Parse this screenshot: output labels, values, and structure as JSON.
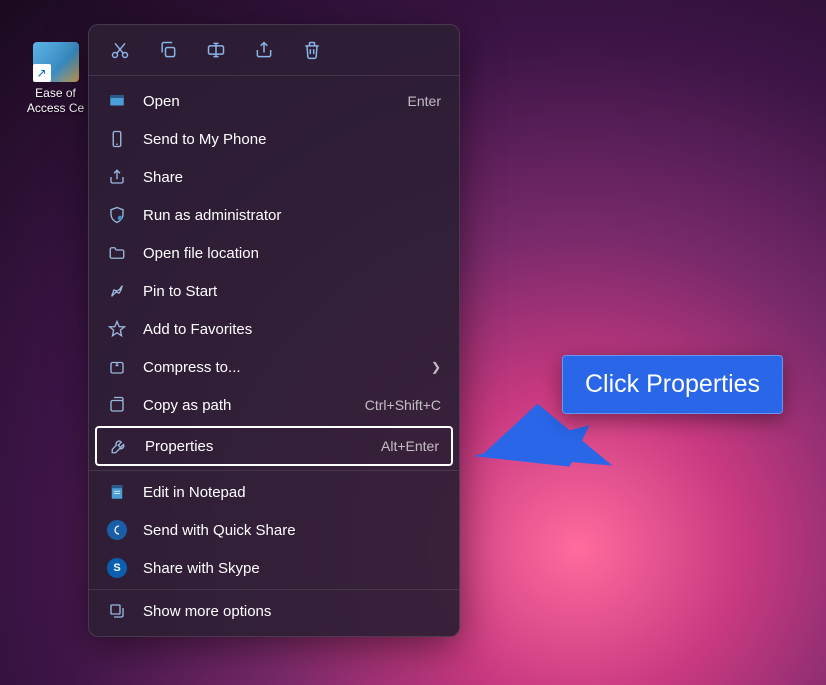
{
  "desktop_icon": {
    "label": "Ease of\nAccess Ce"
  },
  "toolbar": {
    "items": [
      "cut-icon",
      "copy-icon",
      "rename-icon",
      "share-icon",
      "delete-icon"
    ]
  },
  "menu": {
    "sections": [
      [
        {
          "id": "open",
          "label": "Open",
          "shortcut": "Enter",
          "icon": "open"
        },
        {
          "id": "send-to-phone",
          "label": "Send to My Phone",
          "icon": "phone"
        },
        {
          "id": "share",
          "label": "Share",
          "icon": "share"
        },
        {
          "id": "run-admin",
          "label": "Run as administrator",
          "icon": "shield"
        },
        {
          "id": "open-location",
          "label": "Open file location",
          "icon": "folder"
        },
        {
          "id": "pin-start",
          "label": "Pin to Start",
          "icon": "pin"
        },
        {
          "id": "add-favorites",
          "label": "Add to Favorites",
          "icon": "star"
        },
        {
          "id": "compress",
          "label": "Compress to...",
          "icon": "archive",
          "submenu": true
        },
        {
          "id": "copy-path",
          "label": "Copy as path",
          "shortcut": "Ctrl+Shift+C",
          "icon": "copypath"
        },
        {
          "id": "properties",
          "label": "Properties",
          "shortcut": "Alt+Enter",
          "icon": "wrench",
          "highlighted": true
        }
      ],
      [
        {
          "id": "edit-notepad",
          "label": "Edit in Notepad",
          "icon": "notepad"
        },
        {
          "id": "quick-share",
          "label": "Send with Quick Share",
          "icon": "quickshare"
        },
        {
          "id": "skype-share",
          "label": "Share with Skype",
          "icon": "skype"
        }
      ],
      [
        {
          "id": "more-options",
          "label": "Show more options",
          "icon": "more"
        }
      ]
    ]
  },
  "callout": {
    "text": "Click Properties"
  }
}
